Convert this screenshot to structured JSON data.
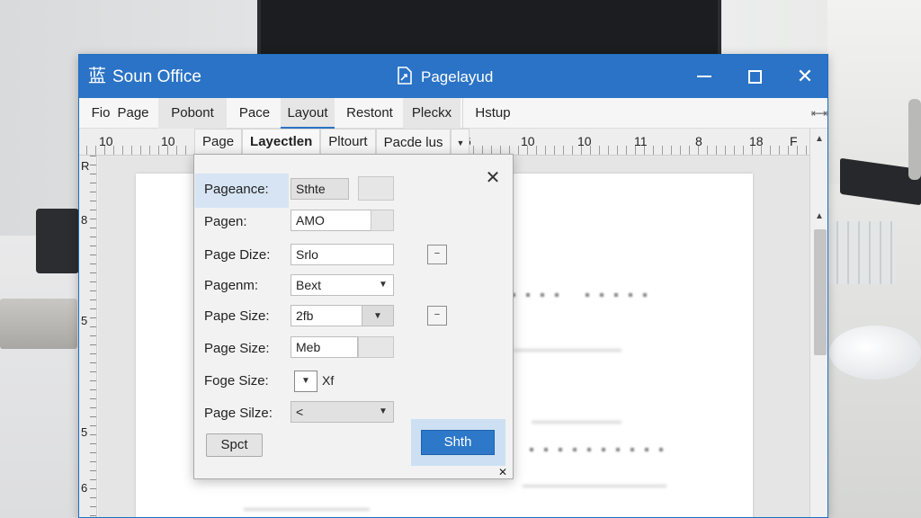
{
  "window": {
    "app_icon": "蓝",
    "app_title": "Soun Office",
    "doc_title": "Pagelayud",
    "close_glyph": "✕"
  },
  "menu": {
    "items": [
      "Fio",
      "Page",
      "Pobont",
      "Pace",
      "Layout",
      "Restont",
      "Pleckx",
      "Hstup"
    ],
    "active": "Layout",
    "collapse_glyph": "⇤⇥"
  },
  "ruler": {
    "numbers": [
      "10",
      "10",
      "6",
      "10",
      "10",
      "11",
      "8",
      "18",
      "F"
    ],
    "subtabs": [
      "Page",
      "Layectlen",
      "Pltourt",
      "Pacde lus"
    ]
  },
  "vruler": {
    "numbers": [
      "R",
      "8",
      "5",
      "5",
      "6"
    ]
  },
  "dialog": {
    "close_glyph": "✕",
    "close_small": "✕",
    "rows": [
      {
        "label": "Pageance:",
        "value": "Sthte"
      },
      {
        "label": "Pagen:",
        "value": "AMO"
      },
      {
        "label": "Page Dize:",
        "value": "Srlo"
      },
      {
        "label": "Pagenm:",
        "value": "Bext"
      },
      {
        "label": "Pape Size:",
        "value": "2fb"
      },
      {
        "label": "Page Size:",
        "value": "Meb"
      },
      {
        "label": "Foge Size:",
        "value": "Xf"
      },
      {
        "label": "Page Silze:",
        "value": "<"
      }
    ],
    "mini_button_glyph": "−",
    "dropdown_glyph": "▼",
    "secondary_button": "Spct",
    "primary_button": "Shth"
  },
  "colors": {
    "titlebar": "#2a73c6",
    "primary_button": "#2d78c8",
    "selection": "#d6e4f3"
  }
}
